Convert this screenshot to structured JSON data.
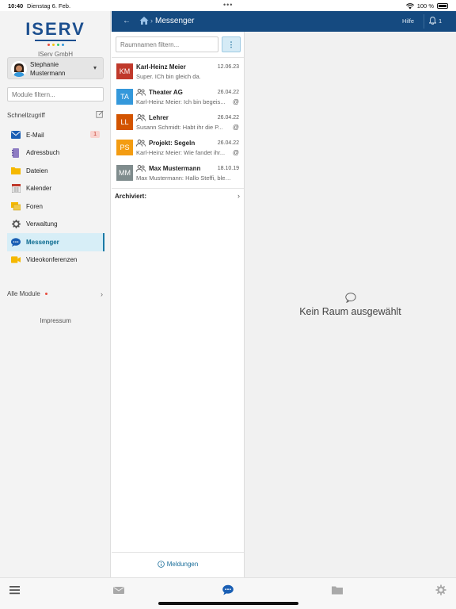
{
  "status_bar": {
    "time": "10:40",
    "date": "Dienstag 6. Feb.",
    "dots": "•••",
    "battery": "100 %"
  },
  "sidebar": {
    "logo_text": "ISERV",
    "org_name": "IServ GmbH",
    "user": {
      "name": "Stephanie Mustermann"
    },
    "module_filter_placeholder": "Module filtern...",
    "quick_access_label": "Schnellzugriff",
    "items": [
      {
        "label": "E-Mail",
        "icon": "mail-icon",
        "badge": "1"
      },
      {
        "label": "Adressbuch",
        "icon": "address-book-icon"
      },
      {
        "label": "Dateien",
        "icon": "folder-icon"
      },
      {
        "label": "Kalender",
        "icon": "calendar-icon"
      },
      {
        "label": "Foren",
        "icon": "forum-icon"
      },
      {
        "label": "Verwaltung",
        "icon": "gear-icon"
      },
      {
        "label": "Messenger",
        "icon": "chat-icon",
        "active": true
      },
      {
        "label": "Videokonferenzen",
        "icon": "video-icon"
      }
    ],
    "all_modules_label": "Alle Module",
    "impressum_label": "Impressum"
  },
  "header": {
    "title": "Messenger",
    "help_label": "Hilfe",
    "notification_count": "1"
  },
  "rooms": {
    "filter_placeholder": "Raumnamen filtern...",
    "more_label": "⋮",
    "list": [
      {
        "initials": "KM",
        "color": "#c0392b",
        "name": "Karl-Heinz Meier",
        "date": "12.06.23",
        "message": "Super. ICh bin gleich da.",
        "group": false,
        "mention": ""
      },
      {
        "initials": "TA",
        "color": "#3498db",
        "name": "Theater AG",
        "date": "26.04.22",
        "message": "Karl-Heinz Meier: Ich bin begeis...",
        "group": true,
        "mention": "@"
      },
      {
        "initials": "LL",
        "color": "#d35400",
        "name": "Lehrer",
        "date": "26.04.22",
        "message": "Susann Schmidt: Habt ihr die P...",
        "group": true,
        "mention": "@"
      },
      {
        "initials": "PS",
        "color": "#f39c12",
        "name": "Projekt: Segeln",
        "date": "26.04.22",
        "message": "Karl-Heinz Meier: Wie fandet ihr...",
        "group": true,
        "mention": "@"
      },
      {
        "initials": "MM",
        "color": "#7f8c8d",
        "name": "Max Mustermann",
        "date": "18.10.19",
        "message": "Max Mustermann: Hallo Steffi, blei...",
        "group": true,
        "mention": ""
      }
    ],
    "archived_label": "Archiviert:",
    "notifications_label": "Meldungen"
  },
  "main": {
    "empty_text": "Kein Raum ausgewählt"
  },
  "colors": {
    "header_bg": "#154a80",
    "active_nav_bg": "#d7eef7",
    "accent": "#1b6e9a"
  }
}
